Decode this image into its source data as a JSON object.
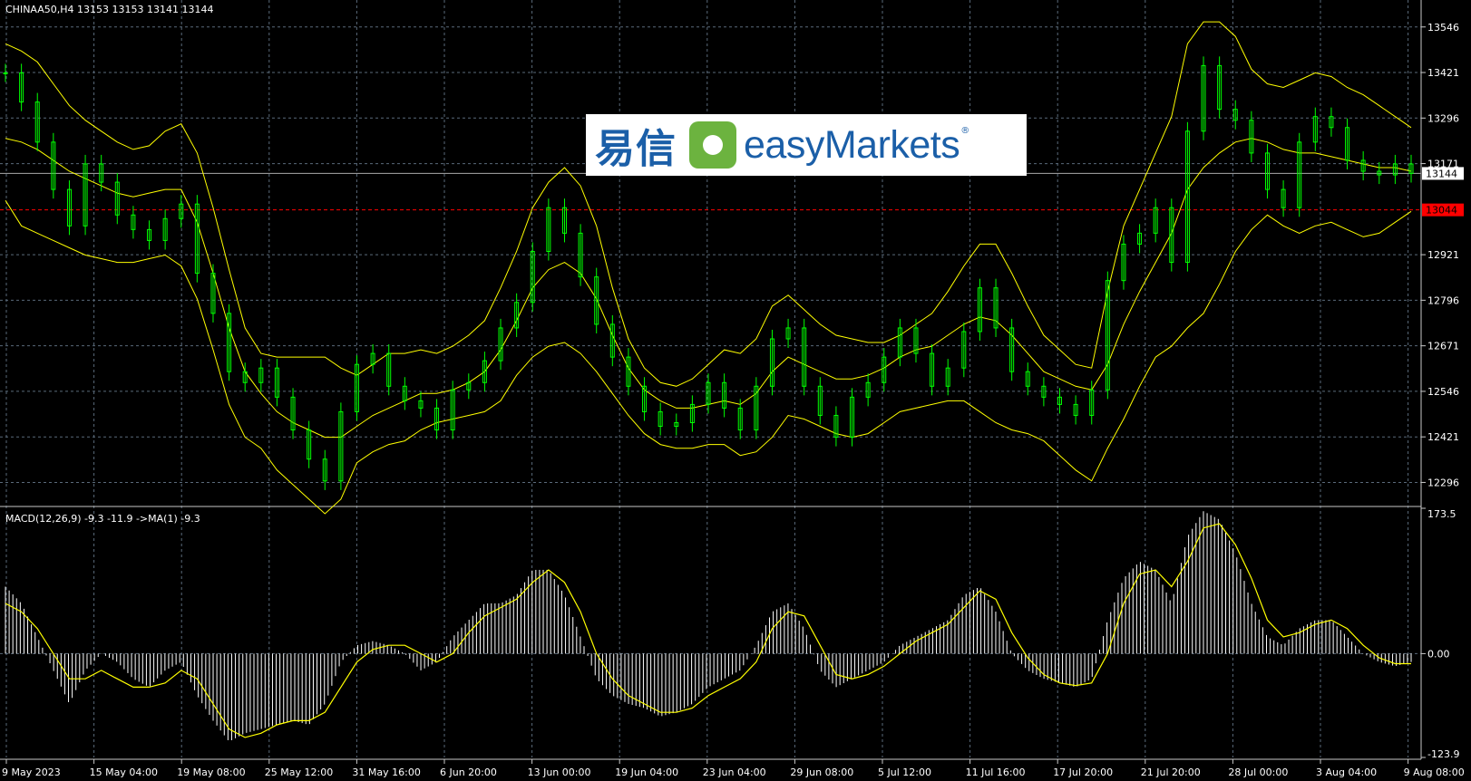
{
  "main_panel": {
    "title": "CHINAA50,H4  13153 13153 13141 13144",
    "current_price_label": "13144",
    "ref_line_label": "13044"
  },
  "macd_panel": {
    "title": "MACD(12,26,9) -9.3 -11.9  ->MA(1) -9.3"
  },
  "logo": {
    "cn": "易信",
    "en": "easyMarkets",
    "reg": "®"
  },
  "colors": {
    "background": "#000000",
    "candle": "#00ff00",
    "bands": "#ffff00",
    "ref_line": "#ff0000",
    "histogram": "#ffffff",
    "signal": "#ffff00",
    "grid": "#5a6a7a"
  },
  "chart_data": [
    {
      "type": "line",
      "panel": "price",
      "ylim": [
        12230,
        13620
      ],
      "y_ticks": [
        13546,
        13421,
        13296,
        13171,
        12921,
        12796,
        12671,
        12546,
        12421,
        12296
      ],
      "x_tick_labels": [
        "9 May 2023",
        "15 May 04:00",
        "19 May 08:00",
        "25 May 12:00",
        "31 May 16:00",
        "6 Jun 20:00",
        "13 Jun 00:00",
        "19 Jun 04:00",
        "23 Jun 04:00",
        "29 Jun 08:00",
        "5 Jul 12:00",
        "11 Jul 16:00",
        "17 Jul 20:00",
        "21 Jul 20:00",
        "28 Jul 00:00",
        "3 Aug 04:00",
        "9 Aug 08:00"
      ],
      "current_price": 13144,
      "reference_level": 13044,
      "series": [
        {
          "role": "close",
          "values": [
            13420,
            13340,
            13230,
            13100,
            13000,
            13170,
            13120,
            13030,
            12990,
            12960,
            13020,
            13060,
            12870,
            12760,
            12600,
            12570,
            12610,
            12530,
            12440,
            12360,
            12300,
            12490,
            12620,
            12650,
            12560,
            12520,
            12500,
            12440,
            12550,
            12570,
            12630,
            12720,
            12790,
            12930,
            13050,
            12980,
            12860,
            12730,
            12640,
            12560,
            12490,
            12450,
            12460,
            12510,
            12570,
            12500,
            12440,
            12560,
            12690,
            12720,
            12560,
            12480,
            12420,
            12530,
            12570,
            12640,
            12720,
            12650,
            12560,
            12610,
            12710,
            12830,
            12720,
            12600,
            12560,
            12530,
            12510,
            12480,
            12550,
            12850,
            12950,
            12980,
            13050,
            12900,
            13260,
            13440,
            13320,
            13290,
            13200,
            13100,
            13050,
            13230,
            13300,
            13270,
            13180,
            13150,
            13140,
            13170,
            13144
          ]
        },
        {
          "role": "upper_band",
          "values": [
            13500,
            13480,
            13450,
            13390,
            13330,
            13290,
            13260,
            13230,
            13210,
            13220,
            13260,
            13280,
            13200,
            13050,
            12880,
            12720,
            12650,
            12640,
            12640,
            12640,
            12640,
            12610,
            12590,
            12620,
            12650,
            12650,
            12660,
            12650,
            12670,
            12700,
            12740,
            12830,
            12930,
            13050,
            13120,
            13160,
            13110,
            13000,
            12830,
            12690,
            12610,
            12570,
            12560,
            12580,
            12620,
            12660,
            12650,
            12690,
            12780,
            12810,
            12770,
            12730,
            12700,
            12690,
            12680,
            12680,
            12700,
            12730,
            12760,
            12820,
            12890,
            12950,
            12950,
            12870,
            12780,
            12700,
            12660,
            12620,
            12610,
            12820,
            13000,
            13100,
            13200,
            13300,
            13500,
            13560,
            13560,
            13520,
            13430,
            13390,
            13380,
            13400,
            13420,
            13410,
            13380,
            13360,
            13330,
            13300,
            13270
          ]
        },
        {
          "role": "middle_band",
          "values": [
            13240,
            13230,
            13210,
            13180,
            13150,
            13130,
            13110,
            13090,
            13080,
            13090,
            13100,
            13100,
            13010,
            12870,
            12720,
            12600,
            12540,
            12490,
            12460,
            12440,
            12420,
            12420,
            12450,
            12480,
            12500,
            12520,
            12540,
            12540,
            12550,
            12570,
            12600,
            12660,
            12740,
            12830,
            12880,
            12900,
            12870,
            12800,
            12700,
            12610,
            12550,
            12520,
            12500,
            12500,
            12510,
            12520,
            12510,
            12540,
            12600,
            12640,
            12620,
            12600,
            12580,
            12580,
            12590,
            12610,
            12640,
            12660,
            12670,
            12700,
            12730,
            12750,
            12740,
            12700,
            12650,
            12600,
            12580,
            12560,
            12550,
            12620,
            12730,
            12820,
            12900,
            12980,
            13100,
            13160,
            13200,
            13230,
            13240,
            13230,
            13210,
            13200,
            13200,
            13190,
            13180,
            13170,
            13160,
            13160,
            13150
          ]
        },
        {
          "role": "lower_band",
          "values": [
            13070,
            13000,
            12980,
            12960,
            12940,
            12920,
            12910,
            12900,
            12900,
            12910,
            12920,
            12890,
            12800,
            12660,
            12510,
            12420,
            12390,
            12330,
            12290,
            12250,
            12210,
            12250,
            12350,
            12380,
            12400,
            12410,
            12440,
            12460,
            12470,
            12480,
            12490,
            12520,
            12590,
            12640,
            12670,
            12680,
            12650,
            12600,
            12540,
            12480,
            12430,
            12400,
            12390,
            12390,
            12400,
            12400,
            12370,
            12380,
            12420,
            12480,
            12470,
            12450,
            12430,
            12420,
            12430,
            12460,
            12490,
            12500,
            12510,
            12520,
            12520,
            12490,
            12460,
            12440,
            12430,
            12410,
            12370,
            12330,
            12300,
            12390,
            12470,
            12560,
            12640,
            12670,
            12720,
            12760,
            12840,
            12930,
            12990,
            13030,
            13000,
            12980,
            13000,
            13010,
            12990,
            12970,
            12980,
            13010,
            13040
          ]
        }
      ]
    },
    {
      "type": "bar",
      "panel": "macd",
      "ylim": [
        -123.9,
        173.5
      ],
      "y_ticks": [
        173.5,
        0.0,
        -123.9
      ],
      "series": [
        {
          "role": "macd_histogram",
          "values": [
            80,
            60,
            20,
            -20,
            -60,
            -20,
            0,
            -10,
            -30,
            -40,
            -20,
            -10,
            -50,
            -80,
            -105,
            -95,
            -90,
            -85,
            -80,
            -85,
            -60,
            -10,
            10,
            15,
            10,
            0,
            -20,
            -10,
            20,
            40,
            60,
            60,
            70,
            100,
            100,
            70,
            20,
            -30,
            -50,
            -60,
            -65,
            -75,
            -70,
            -60,
            -40,
            -30,
            -20,
            10,
            50,
            60,
            30,
            -20,
            -40,
            -30,
            -20,
            -10,
            10,
            20,
            30,
            40,
            70,
            80,
            50,
            0,
            -20,
            -30,
            -35,
            -40,
            -30,
            40,
            90,
            110,
            100,
            60,
            140,
            170,
            160,
            120,
            60,
            20,
            10,
            30,
            40,
            40,
            20,
            0,
            -10,
            -15,
            -10
          ]
        },
        {
          "role": "signal",
          "values": [
            60,
            50,
            30,
            0,
            -30,
            -30,
            -20,
            -30,
            -40,
            -40,
            -35,
            -20,
            -30,
            -60,
            -90,
            -100,
            -95,
            -85,
            -80,
            -80,
            -70,
            -40,
            -10,
            5,
            10,
            10,
            0,
            -10,
            0,
            25,
            45,
            55,
            65,
            85,
            100,
            85,
            50,
            0,
            -30,
            -50,
            -60,
            -70,
            -70,
            -65,
            -50,
            -40,
            -30,
            -10,
            30,
            50,
            45,
            10,
            -25,
            -30,
            -25,
            -15,
            0,
            15,
            25,
            35,
            55,
            75,
            65,
            25,
            -5,
            -25,
            -35,
            -38,
            -35,
            0,
            60,
            95,
            100,
            80,
            110,
            150,
            155,
            130,
            90,
            40,
            20,
            25,
            35,
            40,
            30,
            10,
            -5,
            -12,
            -12
          ]
        }
      ]
    }
  ]
}
